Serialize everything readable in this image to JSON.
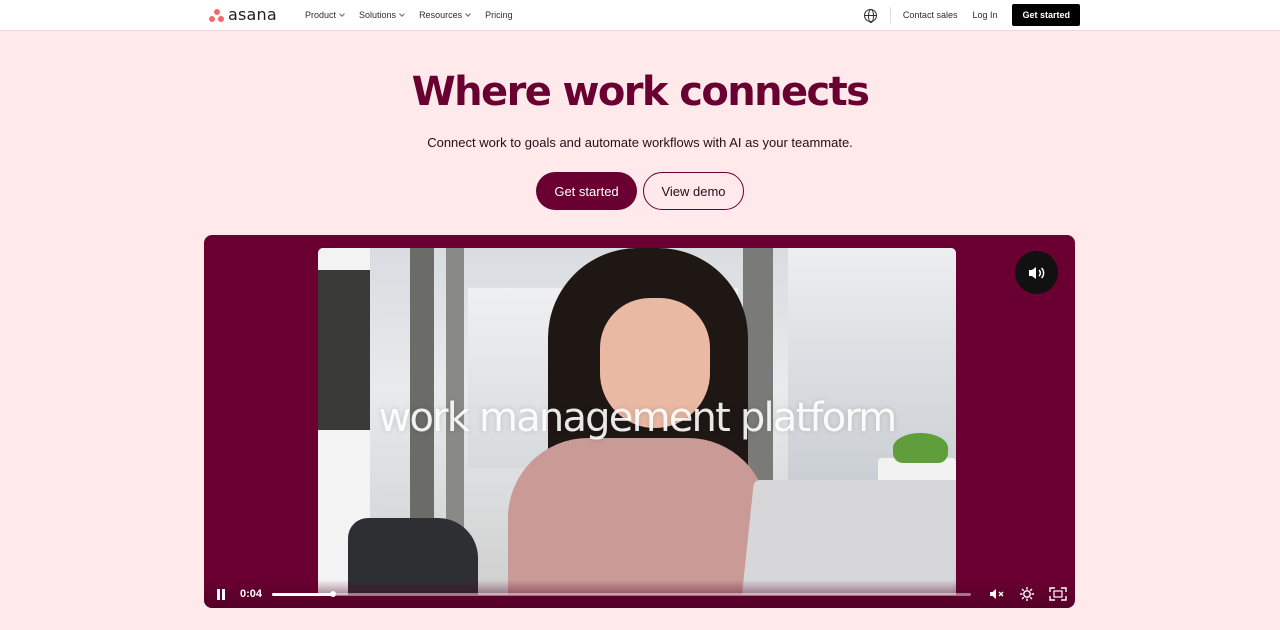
{
  "nav": {
    "logo_text": "asana",
    "links": [
      {
        "label": "Product",
        "has_dropdown": true
      },
      {
        "label": "Solutions",
        "has_dropdown": true
      },
      {
        "label": "Resources",
        "has_dropdown": true
      },
      {
        "label": "Pricing",
        "has_dropdown": false
      }
    ],
    "language_icon": "globe-icon",
    "contact_sales": "Contact sales",
    "log_in": "Log In",
    "get_started": "Get started"
  },
  "hero": {
    "title": "Where work connects",
    "subtitle": "Connect work to goals and automate workflows with AI as your teammate.",
    "primary_cta": "Get started",
    "secondary_cta": "View demo"
  },
  "video": {
    "overlay_caption": "work management platform",
    "time": "0:04",
    "progress": 0.087,
    "sound_icon": "speaker-icon",
    "pause_icon": "pause-icon",
    "mute_icon": "mute-icon",
    "settings_icon": "settings-icon",
    "fullscreen_icon": "fullscreen-icon"
  },
  "colors": {
    "brand_plum": "#690031",
    "background_pink": "#ffe9ea",
    "logo_coral": "#f06a6a",
    "nav_button": "#000000"
  }
}
